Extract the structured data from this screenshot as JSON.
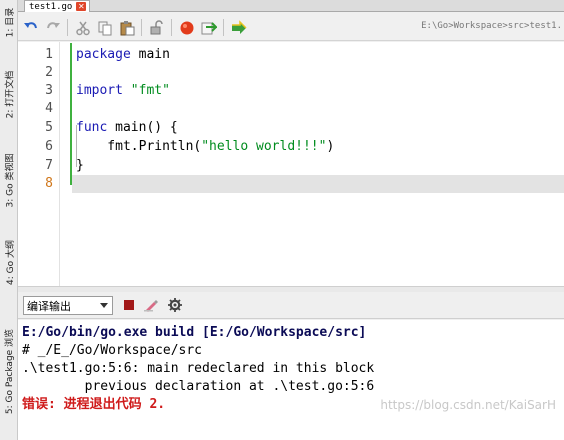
{
  "left_dock": {
    "tabs": [
      {
        "label": "1: 目录"
      },
      {
        "label": "2: 打开文档"
      },
      {
        "label": "3: Go 类视图"
      },
      {
        "label": "4: Go 大纲"
      },
      {
        "label": "5: Go Package 浏览"
      }
    ]
  },
  "editor_tab": {
    "label": "test1.go",
    "close_glyph": "✕"
  },
  "toolbar": {
    "path": "E:\\Go>Workspace>src>test1.",
    "icons": [
      "undo-icon",
      "redo-icon",
      "cut-icon",
      "copy-icon",
      "paste-icon",
      "lock-icon",
      "record-icon",
      "run-to-cursor-icon",
      "build-run-icon"
    ]
  },
  "editor": {
    "line_numbers": [
      "1",
      "2",
      "3",
      "4",
      "5",
      "6",
      "7",
      "8"
    ],
    "code": {
      "l1_kw": "package",
      "l1_rest": " main",
      "l3_kw": "import",
      "l3_sp": " ",
      "l3_str": "\"fmt\"",
      "l5_kw": "func",
      "l5_rest": " main() {",
      "l6_pre": "    fmt.Println(",
      "l6_str": "\"hello world!!!\"",
      "l6_post": ")",
      "l7": "}"
    }
  },
  "output_panel": {
    "selector": {
      "value": "编译输出"
    },
    "lines": [
      "E:/Go/bin/go.exe build [E:/Go/Workspace/src]",
      "# _/E_/Go/Workspace/src",
      ".\\test1.go:5:6: main redeclared in this block",
      "        previous declaration at .\\test.go:5:6",
      "错误: 进程退出代码 2."
    ]
  },
  "watermark": "https://blog.csdn.net/KaiSarH",
  "colors": {
    "keyword": "#1b1bb4",
    "string": "#008c1e",
    "error": "#cf1b1b",
    "change_bar": "#3fb13f"
  }
}
